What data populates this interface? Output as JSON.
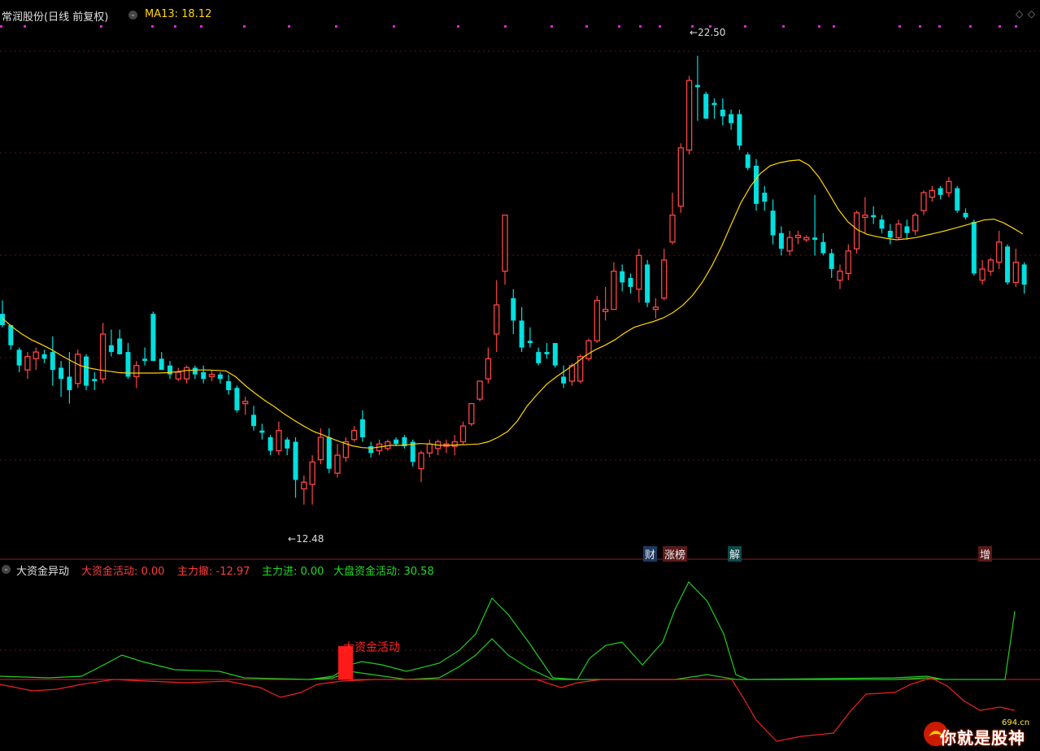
{
  "header": {
    "title": "常润股份(日线 前复权)",
    "ma_label": "MA13: 18.12"
  },
  "indicator": {
    "title": "大资金异动",
    "values": [
      {
        "label": "大资金活动: 0.00",
        "color": "#ff3b3b"
      },
      {
        "label": "主力撤: -12.97",
        "color": "#ff3b3b"
      },
      {
        "label": "主力进: 0.00",
        "color": "#22dd22"
      },
      {
        "label": "大盘资金活动: 30.58",
        "color": "#22dd22"
      }
    ],
    "annotation": "大资金活动"
  },
  "tags": [
    "财",
    "涨榜",
    "解",
    "增"
  ],
  "extremes": {
    "high": "22.50",
    "low": "12.48"
  },
  "watermark": {
    "text": "你就是股神",
    "small": "694.cn"
  },
  "colors": {
    "up": "#ff4444",
    "down": "#00e0e0",
    "ma": "#ffd400",
    "bg": "#000000"
  },
  "chart_data": {
    "type": "candlestick",
    "ylim": [
      11.7,
      23.2
    ],
    "ohlc": [
      [
        16.75,
        17.05,
        16.45,
        16.5
      ],
      [
        16.5,
        16.5,
        15.95,
        16.05
      ],
      [
        15.95,
        16.0,
        15.45,
        15.6
      ],
      [
        15.5,
        15.9,
        15.3,
        15.8
      ],
      [
        15.75,
        16.0,
        15.5,
        15.9
      ],
      [
        15.85,
        15.95,
        15.65,
        15.75
      ],
      [
        15.9,
        16.25,
        15.15,
        15.5
      ],
      [
        15.55,
        15.7,
        14.9,
        15.3
      ],
      [
        15.35,
        15.9,
        14.75,
        15.05
      ],
      [
        15.2,
        15.95,
        15.1,
        15.85
      ],
      [
        15.8,
        15.85,
        15.05,
        15.15
      ],
      [
        15.3,
        15.45,
        15.05,
        15.25
      ],
      [
        15.3,
        16.55,
        15.2,
        16.3
      ],
      [
        16.05,
        16.4,
        15.8,
        15.9
      ],
      [
        16.2,
        16.4,
        15.85,
        15.85
      ],
      [
        15.9,
        16.1,
        15.3,
        15.35
      ],
      [
        15.35,
        15.7,
        15.1,
        15.6
      ],
      [
        15.75,
        16.0,
        15.6,
        15.7
      ],
      [
        16.75,
        16.8,
        15.7,
        15.7
      ],
      [
        15.75,
        15.9,
        15.5,
        15.5
      ],
      [
        15.6,
        15.7,
        15.3,
        15.4
      ],
      [
        15.3,
        15.55,
        15.25,
        15.45
      ],
      [
        15.3,
        15.6,
        15.2,
        15.55
      ],
      [
        15.55,
        15.6,
        15.3,
        15.4
      ],
      [
        15.45,
        15.6,
        15.2,
        15.3
      ],
      [
        15.35,
        15.5,
        15.25,
        15.4
      ],
      [
        15.4,
        15.45,
        15.2,
        15.3
      ],
      [
        15.25,
        15.4,
        14.95,
        15.05
      ],
      [
        15.1,
        15.15,
        14.55,
        14.6
      ],
      [
        14.75,
        14.9,
        14.5,
        14.8
      ],
      [
        14.5,
        14.7,
        14.15,
        14.25
      ],
      [
        14.15,
        14.3,
        13.95,
        14.1
      ],
      [
        14.0,
        14.05,
        13.6,
        13.7
      ],
      [
        13.7,
        14.35,
        13.6,
        14.15
      ],
      [
        13.95,
        14.0,
        13.6,
        13.75
      ],
      [
        13.9,
        14.0,
        12.65,
        13.05
      ],
      [
        12.85,
        13.15,
        12.5,
        13.0
      ],
      [
        12.95,
        13.6,
        12.5,
        13.45
      ],
      [
        13.5,
        14.2,
        13.4,
        14.0
      ],
      [
        14.0,
        14.2,
        13.2,
        13.3
      ],
      [
        13.2,
        13.85,
        13.1,
        13.6
      ],
      [
        13.55,
        14.0,
        13.45,
        13.9
      ],
      [
        13.95,
        14.25,
        13.9,
        14.15
      ],
      [
        14.4,
        14.6,
        13.9,
        14.0
      ],
      [
        13.8,
        13.9,
        13.55,
        13.65
      ],
      [
        13.7,
        13.95,
        13.6,
        13.85
      ],
      [
        13.75,
        13.95,
        13.7,
        13.9
      ],
      [
        13.95,
        14.0,
        13.8,
        13.85
      ],
      [
        14.0,
        14.05,
        13.75,
        13.8
      ],
      [
        13.9,
        13.95,
        13.35,
        13.45
      ],
      [
        13.3,
        13.7,
        13.0,
        13.65
      ],
      [
        13.65,
        13.95,
        13.55,
        13.85
      ],
      [
        13.75,
        13.95,
        13.6,
        13.9
      ],
      [
        13.8,
        13.95,
        13.65,
        13.85
      ],
      [
        13.8,
        14.05,
        13.6,
        13.9
      ],
      [
        13.9,
        14.35,
        13.85,
        14.25
      ],
      [
        14.3,
        14.75,
        14.25,
        14.75
      ],
      [
        14.85,
        15.25,
        14.8,
        15.25
      ],
      [
        15.3,
        16.0,
        15.2,
        15.75
      ],
      [
        16.3,
        17.5,
        15.9,
        16.95
      ],
      [
        17.7,
        18.95,
        17.4,
        18.95
      ],
      [
        17.1,
        17.3,
        16.3,
        16.6
      ],
      [
        16.6,
        16.9,
        15.9,
        16.0
      ],
      [
        16.15,
        16.45,
        16.0,
        16.1
      ],
      [
        15.9,
        16.0,
        15.6,
        15.65
      ],
      [
        15.9,
        16.1,
        15.75,
        15.85
      ],
      [
        16.1,
        16.1,
        15.55,
        15.6
      ],
      [
        15.35,
        15.6,
        15.1,
        15.2
      ],
      [
        15.25,
        15.65,
        15.15,
        15.6
      ],
      [
        15.25,
        15.85,
        15.2,
        15.8
      ],
      [
        15.75,
        16.2,
        15.7,
        16.15
      ],
      [
        16.15,
        17.15,
        16.1,
        17.05
      ],
      [
        16.8,
        17.35,
        16.6,
        16.85
      ],
      [
        16.85,
        17.9,
        16.85,
        17.7
      ],
      [
        17.7,
        17.85,
        17.25,
        17.45
      ],
      [
        17.55,
        17.65,
        17.2,
        17.35
      ],
      [
        17.3,
        18.2,
        17.0,
        18.05
      ],
      [
        17.85,
        17.95,
        16.9,
        17.0
      ],
      [
        16.85,
        17.1,
        16.65,
        16.9
      ],
      [
        17.1,
        18.2,
        17.05,
        17.95
      ],
      [
        18.35,
        19.45,
        18.3,
        18.95
      ],
      [
        19.15,
        20.55,
        19.0,
        20.45
      ],
      [
        20.4,
        22.05,
        20.3,
        21.95
      ],
      [
        21.85,
        22.5,
        21.05,
        21.8
      ],
      [
        21.65,
        21.7,
        21.1,
        21.1
      ],
      [
        21.45,
        21.55,
        21.1,
        21.4
      ],
      [
        21.3,
        21.55,
        20.95,
        21.15
      ],
      [
        21.2,
        21.3,
        20.85,
        21.0
      ],
      [
        21.2,
        21.3,
        20.4,
        20.5
      ],
      [
        20.3,
        20.35,
        19.95,
        20.0
      ],
      [
        20.05,
        20.2,
        19.05,
        19.2
      ],
      [
        19.45,
        19.6,
        19.05,
        19.25
      ],
      [
        19.05,
        19.3,
        18.3,
        18.5
      ],
      [
        18.55,
        18.7,
        18.05,
        18.2
      ],
      [
        18.15,
        18.6,
        18.05,
        18.45
      ],
      [
        18.45,
        18.6,
        18.3,
        18.5
      ],
      [
        18.4,
        18.5,
        18.35,
        18.45
      ],
      [
        18.45,
        19.4,
        18.05,
        18.4
      ],
      [
        18.35,
        18.55,
        18.05,
        18.1
      ],
      [
        18.1,
        18.2,
        17.55,
        17.75
      ],
      [
        17.5,
        17.85,
        17.3,
        17.7
      ],
      [
        17.65,
        18.3,
        17.5,
        18.15
      ],
      [
        18.2,
        19.05,
        18.1,
        19.0
      ],
      [
        18.9,
        19.35,
        18.55,
        18.95
      ],
      [
        18.95,
        19.15,
        18.75,
        18.9
      ],
      [
        18.85,
        18.95,
        18.55,
        18.65
      ],
      [
        18.6,
        18.75,
        18.3,
        18.45
      ],
      [
        18.45,
        18.85,
        18.4,
        18.75
      ],
      [
        18.7,
        18.85,
        18.4,
        18.55
      ],
      [
        18.6,
        19.0,
        18.5,
        18.95
      ],
      [
        19.05,
        19.5,
        18.95,
        19.45
      ],
      [
        19.35,
        19.6,
        19.25,
        19.5
      ],
      [
        19.55,
        19.6,
        19.3,
        19.4
      ],
      [
        19.45,
        19.8,
        19.35,
        19.7
      ],
      [
        19.55,
        19.6,
        19.0,
        19.05
      ],
      [
        19.0,
        19.1,
        18.85,
        18.9
      ],
      [
        18.8,
        18.85,
        17.6,
        17.65
      ],
      [
        17.5,
        17.95,
        17.4,
        17.75
      ],
      [
        17.7,
        18.0,
        17.6,
        17.95
      ],
      [
        17.9,
        18.6,
        17.75,
        18.35
      ],
      [
        18.25,
        18.3,
        17.4,
        17.45
      ],
      [
        17.45,
        18.2,
        17.35,
        17.9
      ],
      [
        17.85,
        17.9,
        17.2,
        17.4
      ]
    ],
    "ma": [
      16.65,
      16.46,
      16.3,
      16.17,
      16.07,
      15.96,
      15.83,
      15.71,
      15.6,
      15.54,
      15.5,
      15.47,
      15.44,
      15.43,
      15.43,
      15.43,
      15.43,
      15.44,
      15.46,
      15.49,
      15.5,
      15.5,
      15.49,
      15.48,
      15.35,
      15.15,
      14.98,
      14.82,
      14.68,
      14.52,
      14.38,
      14.25,
      14.13,
      14.05,
      13.96,
      13.88,
      13.81,
      13.77,
      13.76,
      13.79,
      13.82,
      13.82,
      13.84,
      13.86,
      13.85,
      13.82,
      13.82,
      13.83,
      13.84,
      13.85,
      13.9,
      14.0,
      14.13,
      14.37,
      14.7,
      14.95,
      15.18,
      15.35,
      15.5,
      15.65,
      15.82,
      15.95,
      16.05,
      16.17,
      16.32,
      16.45,
      16.52,
      16.58,
      16.66,
      16.78,
      16.94,
      17.16,
      17.45,
      17.82,
      18.25,
      18.75,
      19.23,
      19.6,
      19.88,
      20.05,
      20.12,
      20.16,
      20.18,
      20.06,
      19.8,
      19.45,
      19.08,
      18.8,
      18.62,
      18.52,
      18.47,
      18.43,
      18.4,
      18.42,
      18.45,
      18.5,
      18.55,
      18.6,
      18.66,
      18.72,
      18.78,
      18.84,
      18.86,
      18.78,
      18.66,
      18.53
    ]
  }
}
